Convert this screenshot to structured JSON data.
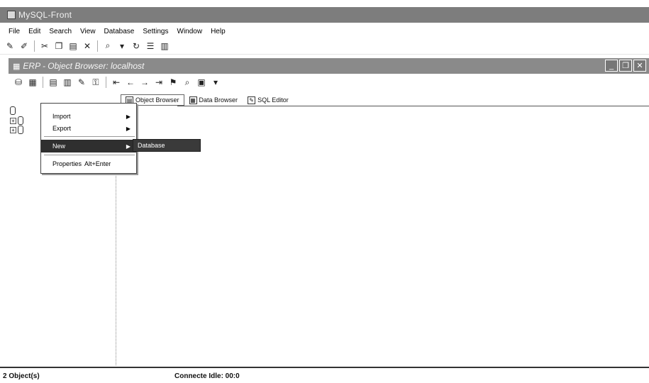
{
  "app": {
    "title": "MySQL-Front"
  },
  "menubar": {
    "items": [
      "File",
      "Edit",
      "Search",
      "View",
      "Database",
      "Settings",
      "Window",
      "Help"
    ]
  },
  "child_window": {
    "title": "ERP - Object Browser: localhost"
  },
  "tabs": [
    {
      "label": "Object Browser",
      "active": true
    },
    {
      "label": "Data Browser",
      "active": false
    },
    {
      "label": "SQL Editor",
      "active": false
    }
  ],
  "context_menu": {
    "import": "Import",
    "export": "Export",
    "new": "New",
    "properties": "Properties",
    "properties_shortcut": "Alt+Enter"
  },
  "submenu": {
    "item": "Database"
  },
  "status": {
    "objects": "2 Object(s)",
    "connection": "Connecte Idle: 00:0"
  }
}
